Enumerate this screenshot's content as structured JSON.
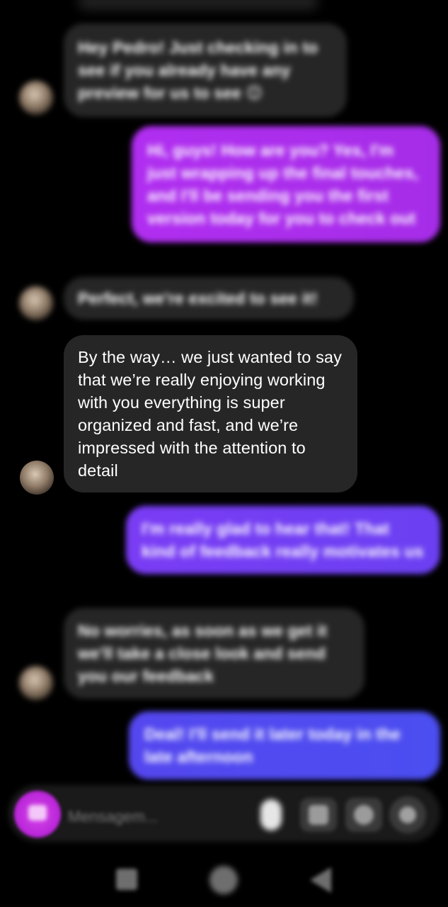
{
  "messages": [
    {
      "id": 1,
      "direction": "incoming",
      "text": "Hey Pedro! Just checking in to see if you already have any preview for us to see 😊"
    },
    {
      "id": 2,
      "direction": "outgoing",
      "text": "Hi, guys! How are you? Yes, I'm just wrapping up the final touches, and I'll be sending you the first version today for you to check out"
    },
    {
      "id": 3,
      "direction": "incoming",
      "text": "Perfect, we're excited to see it!"
    },
    {
      "id": 4,
      "direction": "incoming",
      "text": "By the way… we just wanted to say that we’re really enjoying working with you everything is super organized and fast, and we’re impressed with the attention to detail"
    },
    {
      "id": 5,
      "direction": "outgoing",
      "text": "I'm really glad to hear that! That kind of feedback really motivates us"
    },
    {
      "id": 6,
      "direction": "incoming",
      "text": "No worries, as soon as we get it we'll take a close look and send you our feedback"
    },
    {
      "id": 7,
      "direction": "outgoing",
      "text": "Deal! I'll send it later today in the late afternoon"
    }
  ],
  "composer": {
    "placeholder": "Mensagem..."
  },
  "icons": {
    "camera": "camera-icon",
    "mic": "microphone-icon",
    "gallery": "gallery-icon",
    "sticker": "sticker-icon",
    "add": "add-icon",
    "nav_recent": "recent-apps-icon",
    "nav_home": "home-icon",
    "nav_back": "back-icon"
  },
  "colors": {
    "background": "#000000",
    "incoming_bubble": "#262626",
    "outgoing_bubble_1": "#b02ef0",
    "outgoing_bubble_2": "#7a3cf4",
    "outgoing_bubble_3": "#5447ef",
    "camera_button": "#c42ee0"
  }
}
